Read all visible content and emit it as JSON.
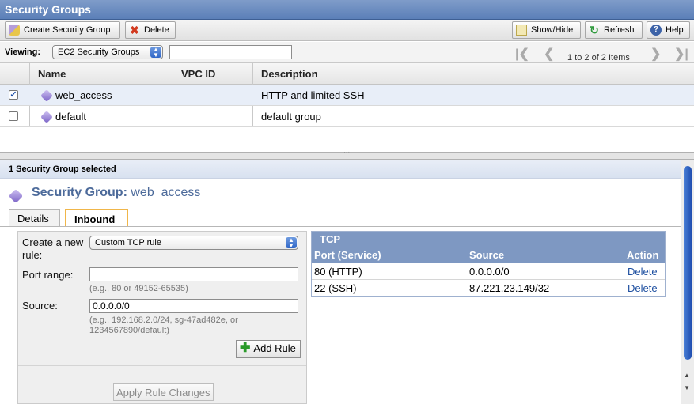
{
  "window": {
    "title": "Security Groups"
  },
  "toolbar": {
    "create_label": "Create Security Group",
    "delete_label": "Delete",
    "showhide_label": "Show/Hide",
    "refresh_label": "Refresh",
    "help_label": "Help",
    "icons": [
      "create-group-icon",
      "delete-x-icon",
      "show-hide-icon",
      "refresh-icon",
      "help-icon"
    ]
  },
  "filter": {
    "viewing_label": "Viewing:",
    "viewing_value": "EC2 Security Groups",
    "search_value": "",
    "pager_text": "1 to 2 of 2 Items"
  },
  "grid": {
    "columns": [
      "Name",
      "VPC ID",
      "Description"
    ],
    "rows": [
      {
        "checked": true,
        "name": "web_access",
        "vpc_id": "",
        "description": "HTTP and limited SSH"
      },
      {
        "checked": false,
        "name": "default",
        "vpc_id": "",
        "description": "default group"
      }
    ]
  },
  "detail": {
    "status": "1 Security Group selected",
    "heading_prefix": "Security Group:",
    "heading_name": "web_access",
    "tabs": [
      "Details",
      "Inbound"
    ],
    "active_tab": "Inbound",
    "form": {
      "create_rule_label": "Create a new rule:",
      "rule_type_value": "Custom TCP rule",
      "port_range_label": "Port range:",
      "port_range_value": "",
      "port_range_hint": "(e.g., 80 or 49152-65535)",
      "source_label": "Source:",
      "source_value": "0.0.0.0/0",
      "source_hint_1": "(e.g., 192.168.2.0/24, sg-47ad482e, or",
      "source_hint_2": "1234567890/default)",
      "add_rule_label": "Add Rule",
      "apply_label": "Apply Rule Changes"
    },
    "rules_table": {
      "protocol": "TCP",
      "headers": [
        "Port (Service)",
        "Source",
        "Action"
      ],
      "rows": [
        {
          "port": "80 (HTTP)",
          "source": "0.0.0.0/0",
          "action": "Delete"
        },
        {
          "port": "22 (SSH)",
          "source": "87.221.23.149/32",
          "action": "Delete"
        }
      ]
    }
  }
}
